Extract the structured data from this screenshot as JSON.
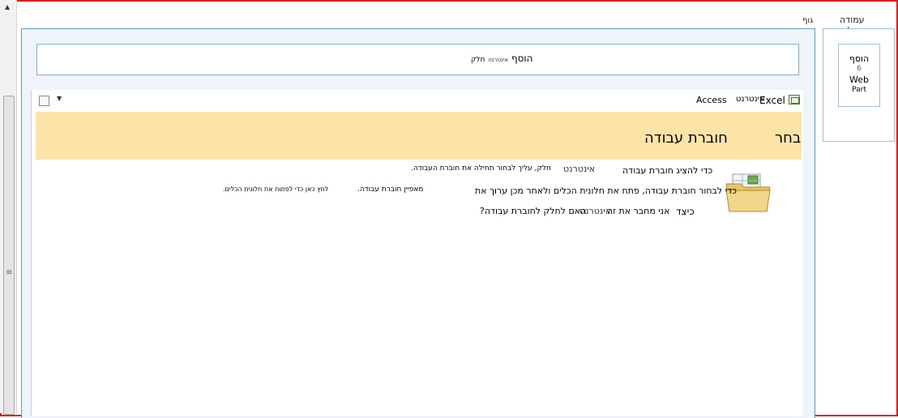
{
  "zones": {
    "left_column_label": "עמודה שמאלית",
    "body_label": "גוף"
  },
  "add_webpart_bar": {
    "add": "הוסף",
    "intranet": "אינטרנט",
    "part": "חלק"
  },
  "left_add_webpart": {
    "add": "הוסף",
    "number": "6",
    "web": "Web",
    "part": "Part"
  },
  "toolbar": {
    "excel": "Excel",
    "intranet": "אינטרנט",
    "access": "Access",
    "dropdown_icon": "chevron-down-icon"
  },
  "banner": {
    "choose": "בחר",
    "workbook": "חוברת עבודה"
  },
  "instructions": {
    "line1_right": "כדי להציג חוברת עבודה",
    "line1_intranet": "אינטרנט",
    "line1_left": "חלק, עליך לבחור תחילה את חוברת העבודה.",
    "line2_right": "כדי לבחור חוברת עבודה, פתח את חלונית הכלים ולאחר מכן ערוך את",
    "line2_mid": "מאפיין חוברת עבודה.",
    "line2_left": "לחץ כאן כדי לפתוח את חלונית הכלים.",
    "line3_how": "כיצד",
    "line3_connect": "אני מחבר את זה",
    "line3_intranet": "אינטרנט",
    "line3_rest": "האם לחלק לחוברת עבודה?"
  },
  "colors": {
    "banner": "#fbe4a6",
    "zone_border": "#5a9bc8",
    "frame": "#e21a1a"
  }
}
